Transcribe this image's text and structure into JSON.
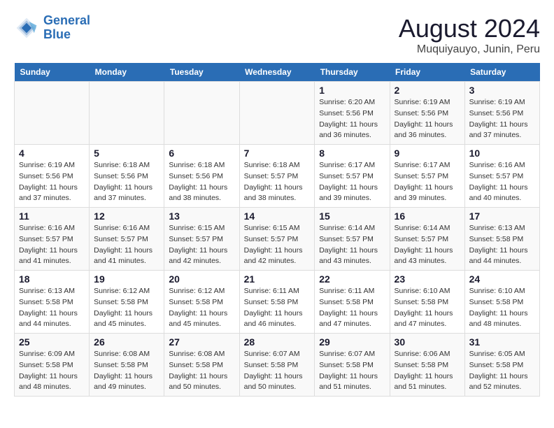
{
  "header": {
    "logo_line1": "General",
    "logo_line2": "Blue",
    "main_title": "August 2024",
    "sub_title": "Muquiyauyo, Junin, Peru"
  },
  "days_of_week": [
    "Sunday",
    "Monday",
    "Tuesday",
    "Wednesday",
    "Thursday",
    "Friday",
    "Saturday"
  ],
  "weeks": [
    [
      {
        "day": "",
        "info": ""
      },
      {
        "day": "",
        "info": ""
      },
      {
        "day": "",
        "info": ""
      },
      {
        "day": "",
        "info": ""
      },
      {
        "day": "1",
        "info": "Sunrise: 6:20 AM\nSunset: 5:56 PM\nDaylight: 11 hours and 36 minutes."
      },
      {
        "day": "2",
        "info": "Sunrise: 6:19 AM\nSunset: 5:56 PM\nDaylight: 11 hours and 36 minutes."
      },
      {
        "day": "3",
        "info": "Sunrise: 6:19 AM\nSunset: 5:56 PM\nDaylight: 11 hours and 37 minutes."
      }
    ],
    [
      {
        "day": "4",
        "info": "Sunrise: 6:19 AM\nSunset: 5:56 PM\nDaylight: 11 hours and 37 minutes."
      },
      {
        "day": "5",
        "info": "Sunrise: 6:18 AM\nSunset: 5:56 PM\nDaylight: 11 hours and 37 minutes."
      },
      {
        "day": "6",
        "info": "Sunrise: 6:18 AM\nSunset: 5:56 PM\nDaylight: 11 hours and 38 minutes."
      },
      {
        "day": "7",
        "info": "Sunrise: 6:18 AM\nSunset: 5:57 PM\nDaylight: 11 hours and 38 minutes."
      },
      {
        "day": "8",
        "info": "Sunrise: 6:17 AM\nSunset: 5:57 PM\nDaylight: 11 hours and 39 minutes."
      },
      {
        "day": "9",
        "info": "Sunrise: 6:17 AM\nSunset: 5:57 PM\nDaylight: 11 hours and 39 minutes."
      },
      {
        "day": "10",
        "info": "Sunrise: 6:16 AM\nSunset: 5:57 PM\nDaylight: 11 hours and 40 minutes."
      }
    ],
    [
      {
        "day": "11",
        "info": "Sunrise: 6:16 AM\nSunset: 5:57 PM\nDaylight: 11 hours and 41 minutes."
      },
      {
        "day": "12",
        "info": "Sunrise: 6:16 AM\nSunset: 5:57 PM\nDaylight: 11 hours and 41 minutes."
      },
      {
        "day": "13",
        "info": "Sunrise: 6:15 AM\nSunset: 5:57 PM\nDaylight: 11 hours and 42 minutes."
      },
      {
        "day": "14",
        "info": "Sunrise: 6:15 AM\nSunset: 5:57 PM\nDaylight: 11 hours and 42 minutes."
      },
      {
        "day": "15",
        "info": "Sunrise: 6:14 AM\nSunset: 5:57 PM\nDaylight: 11 hours and 43 minutes."
      },
      {
        "day": "16",
        "info": "Sunrise: 6:14 AM\nSunset: 5:57 PM\nDaylight: 11 hours and 43 minutes."
      },
      {
        "day": "17",
        "info": "Sunrise: 6:13 AM\nSunset: 5:58 PM\nDaylight: 11 hours and 44 minutes."
      }
    ],
    [
      {
        "day": "18",
        "info": "Sunrise: 6:13 AM\nSunset: 5:58 PM\nDaylight: 11 hours and 44 minutes."
      },
      {
        "day": "19",
        "info": "Sunrise: 6:12 AM\nSunset: 5:58 PM\nDaylight: 11 hours and 45 minutes."
      },
      {
        "day": "20",
        "info": "Sunrise: 6:12 AM\nSunset: 5:58 PM\nDaylight: 11 hours and 45 minutes."
      },
      {
        "day": "21",
        "info": "Sunrise: 6:11 AM\nSunset: 5:58 PM\nDaylight: 11 hours and 46 minutes."
      },
      {
        "day": "22",
        "info": "Sunrise: 6:11 AM\nSunset: 5:58 PM\nDaylight: 11 hours and 47 minutes."
      },
      {
        "day": "23",
        "info": "Sunrise: 6:10 AM\nSunset: 5:58 PM\nDaylight: 11 hours and 47 minutes."
      },
      {
        "day": "24",
        "info": "Sunrise: 6:10 AM\nSunset: 5:58 PM\nDaylight: 11 hours and 48 minutes."
      }
    ],
    [
      {
        "day": "25",
        "info": "Sunrise: 6:09 AM\nSunset: 5:58 PM\nDaylight: 11 hours and 48 minutes."
      },
      {
        "day": "26",
        "info": "Sunrise: 6:08 AM\nSunset: 5:58 PM\nDaylight: 11 hours and 49 minutes."
      },
      {
        "day": "27",
        "info": "Sunrise: 6:08 AM\nSunset: 5:58 PM\nDaylight: 11 hours and 50 minutes."
      },
      {
        "day": "28",
        "info": "Sunrise: 6:07 AM\nSunset: 5:58 PM\nDaylight: 11 hours and 50 minutes."
      },
      {
        "day": "29",
        "info": "Sunrise: 6:07 AM\nSunset: 5:58 PM\nDaylight: 11 hours and 51 minutes."
      },
      {
        "day": "30",
        "info": "Sunrise: 6:06 AM\nSunset: 5:58 PM\nDaylight: 11 hours and 51 minutes."
      },
      {
        "day": "31",
        "info": "Sunrise: 6:05 AM\nSunset: 5:58 PM\nDaylight: 11 hours and 52 minutes."
      }
    ]
  ]
}
